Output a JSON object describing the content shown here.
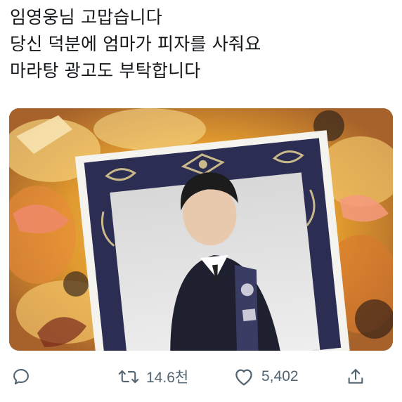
{
  "tweet": {
    "lines": [
      "임영웅님 고맙습니다",
      "당신 덕분에 엄마가 피자를 사줘요",
      "마라탕 광고도 부탁합니다"
    ]
  },
  "media": {
    "description_icon": "photo-card-on-pizza"
  },
  "actions": {
    "reply": {
      "icon": "reply-icon"
    },
    "retweet": {
      "icon": "retweet-icon",
      "count": "14.6천"
    },
    "like": {
      "icon": "heart-icon",
      "count": "5,402"
    },
    "share": {
      "icon": "share-icon"
    }
  },
  "colors": {
    "text": "#14171a",
    "action_gray": "#657786",
    "card_navy": "#2b2d52",
    "card_gold": "#c9b98a"
  }
}
